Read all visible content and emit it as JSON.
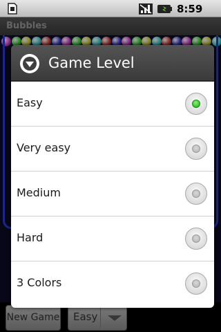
{
  "status_bar": {
    "time": "8:59 PM",
    "icons": [
      "sd-card-icon",
      "signal-icon",
      "battery-icon"
    ]
  },
  "app": {
    "title": "Bubbles"
  },
  "bubble_colors": [
    "#d23bd2",
    "#3bd23b",
    "#d2d23b",
    "#3bd2d2",
    "#d23b3b",
    "#3b3bd2"
  ],
  "dialog": {
    "title": "Game Level",
    "header_icon": "chevron-down-circle-icon",
    "selected_index": 0,
    "options": [
      {
        "label": "Easy",
        "checked": true
      },
      {
        "label": "Very easy",
        "checked": false
      },
      {
        "label": "Medium",
        "checked": false
      },
      {
        "label": "Hard",
        "checked": false
      },
      {
        "label": "3 Colors",
        "checked": false
      }
    ],
    "accent_color": "#1aa514"
  },
  "bottom_bar": {
    "new_game_label": "New Game",
    "level_value": "Easy"
  }
}
